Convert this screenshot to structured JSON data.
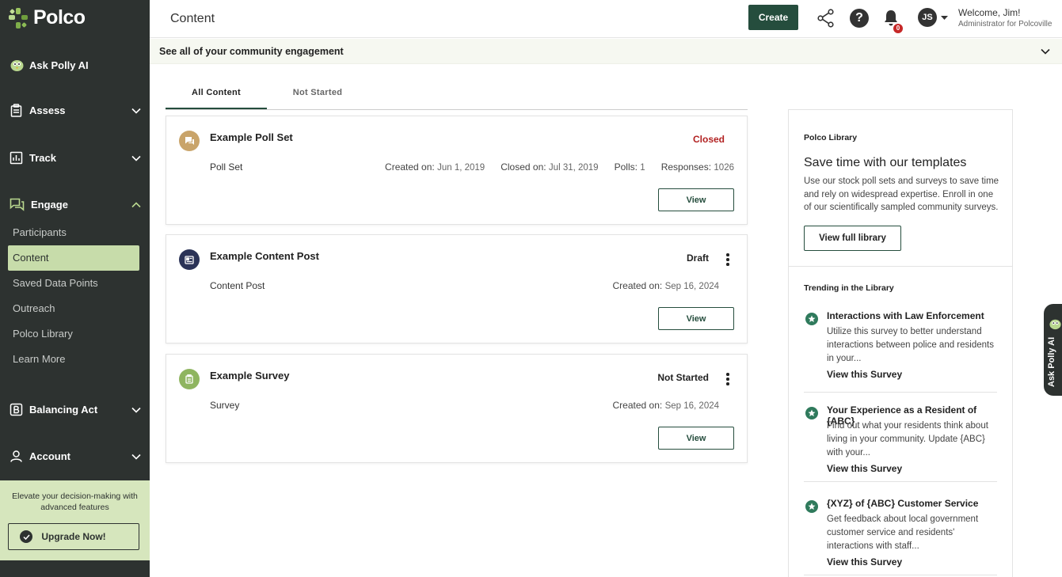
{
  "sidebar": {
    "brand": "Polco",
    "ask_polly": "Ask Polly AI",
    "sections": {
      "assess": "Assess",
      "track": "Track",
      "engage": "Engage",
      "balancing_act": "Balancing Act",
      "account": "Account"
    },
    "engage_items": [
      "Participants",
      "Content",
      "Saved Data Points",
      "Outreach",
      "Polco Library",
      "Learn More"
    ],
    "upgrade_text": "Elevate your decision-making with advanced features",
    "upgrade_button": "Upgrade Now!"
  },
  "header": {
    "title": "Content",
    "create_label": "Create",
    "notification_count": "0",
    "avatar_initials": "JS",
    "welcome": "Welcome, Jim!",
    "role": "Administrator for Polcoville"
  },
  "banner": {
    "text": "See all of your community engagement"
  },
  "tabs": [
    "All Content",
    "Not Started"
  ],
  "cards": [
    {
      "title": "Example Poll Set",
      "type": "Poll Set",
      "status": "Closed",
      "created_label": "Created on:",
      "created": "Jun 1, 2019",
      "closed_label": "Closed on:",
      "closed": "Jul 31, 2019",
      "polls_label": "Polls:",
      "polls": "1",
      "responses_label": "Responses:",
      "responses": "1026",
      "view_label": "View"
    },
    {
      "title": "Example Content Post",
      "type": "Content Post",
      "status": "Draft",
      "created_label": "Created on:",
      "created": "Sep 16, 2024",
      "view_label": "View"
    },
    {
      "title": "Example Survey",
      "type": "Survey",
      "status": "Not Started",
      "created_label": "Created on:",
      "created": "Sep 16, 2024",
      "view_label": "View"
    }
  ],
  "library": {
    "label": "Polco Library",
    "heading": "Save time with our templates",
    "description": "Use our stock poll sets and surveys to save time and rely on widespread expertise. Enroll in one of our scientifically sampled community surveys.",
    "button": "View full library",
    "trending_label": "Trending in the Library",
    "trending": [
      {
        "title": "Interactions with Law Enforcement",
        "desc": "Utilize this survey to better understand interactions between police and residents in your...",
        "link": "View this Survey"
      },
      {
        "title": "Your Experience as a Resident of {ABC}",
        "desc": "Find out what your residents think about living in your community. Update {ABC} with your...",
        "link": "View this Survey"
      },
      {
        "title": "{XYZ} of {ABC} Customer Service",
        "desc": "Get feedback about local government customer service and residents' interactions with staff...",
        "link": "View this Survey"
      }
    ]
  },
  "side_tab": "Ask Polly AI",
  "colors": {
    "sidebar_bg": "#2d3230",
    "accent": "#254d3d",
    "active_green": "#c7dcaa",
    "closed_red": "#b22222"
  }
}
